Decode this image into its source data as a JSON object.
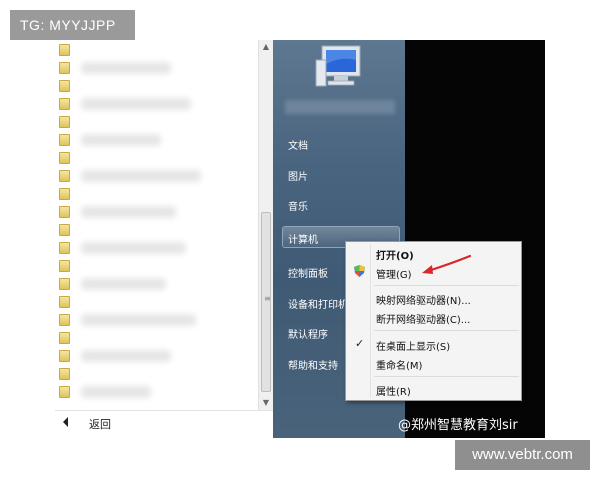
{
  "watermarks": {
    "top_left": "TG: MYYJJPP",
    "bottom_right": "www.vebtr.com"
  },
  "start_menu": {
    "left_panel": {
      "back_label": "返回"
    },
    "right_panel": {
      "items": [
        {
          "label": "文档"
        },
        {
          "label": "图片"
        },
        {
          "label": "音乐"
        },
        {
          "label": "计算机"
        },
        {
          "label": "控制面板"
        },
        {
          "label": "设备和打印机"
        },
        {
          "label": "默认程序"
        },
        {
          "label": "帮助和支持"
        }
      ],
      "hovered_item": "计算机"
    }
  },
  "context_menu": {
    "items": [
      {
        "label": "打开(O)",
        "bold": true
      },
      {
        "label": "管理(G)",
        "icon": "shield-icon"
      },
      {
        "label": "映射网络驱动器(N)..."
      },
      {
        "label": "断开网络驱动器(C)..."
      },
      {
        "label": "在桌面上显示(S)",
        "checked": true
      },
      {
        "label": "重命名(M)"
      },
      {
        "label": "属性(R)"
      }
    ]
  },
  "annotation": {
    "arrow_color": "#d9262b"
  },
  "attribution": "@郑州智慧教育刘sir",
  "colors": {
    "panel_blue": "#4a6580",
    "menu_bg": "#f4f4f4",
    "desktop": "#050505"
  }
}
